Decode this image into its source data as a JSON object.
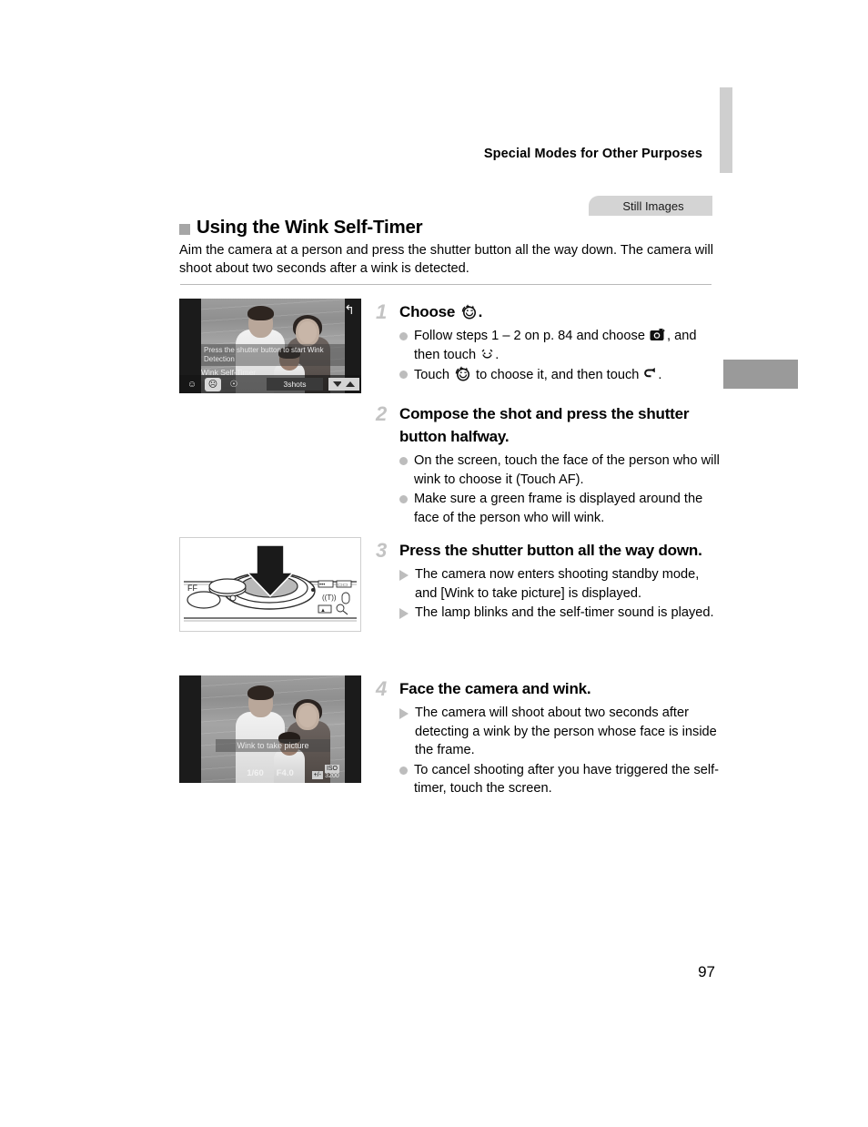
{
  "header": {
    "running_head": "Special Modes for Other Purposes"
  },
  "badge": {
    "label": "Still Images"
  },
  "section": {
    "title": "Using the Wink Self-Timer",
    "intro": "Aim the camera at a person and press the shutter button all the way down. The camera will shoot about two seconds after a wink is detected."
  },
  "figures": {
    "lcd1": {
      "message": "Press the shutter button to start Wink Detection",
      "mode_label": "Wink Self-Timer",
      "shots_value": "3shots",
      "back_icon": "back-arrow-icon",
      "timer_icons": [
        "face-self-timer-icon",
        "wink-self-timer-icon",
        "custom-self-timer-icon"
      ],
      "selected_timer_index": 1,
      "down_arrow": "chevron-down-icon",
      "up_arrow": "chevron-up-icon"
    },
    "camera": {
      "name": "camera-top-shutter-button-diagram",
      "arrow": "press-down-arrow-icon",
      "labels": [
        "FF"
      ]
    },
    "lcd2": {
      "hint": "Wink to take picture",
      "shutter_speed": "1/60",
      "aperture": "F4.0",
      "iso_label": "ISO",
      "iso_value": "3200",
      "exposure_chip": "+/-"
    }
  },
  "steps": [
    {
      "num": "1",
      "title_before": "Choose",
      "title_icon": "wink-self-timer-icon",
      "title_after": ".",
      "items": [
        {
          "marker": "dot",
          "segments": [
            {
              "text": "Follow steps 1 – 2 on p. 84 and choose "
            },
            {
              "icon": "face-self-timer-menu-icon"
            },
            {
              "text": ", and then touch "
            },
            {
              "icon": "smile-face-icon"
            },
            {
              "text": "."
            }
          ]
        },
        {
          "marker": "dot",
          "segments": [
            {
              "text": "Touch "
            },
            {
              "icon": "wink-self-timer-icon"
            },
            {
              "text": " to choose it, and then touch "
            },
            {
              "icon": "back-arrow-icon"
            },
            {
              "text": "."
            }
          ]
        }
      ]
    },
    {
      "num": "2",
      "title_before": "Compose the shot and press the shutter button halfway.",
      "items": [
        {
          "marker": "dot",
          "segments": [
            {
              "text": "On the screen, touch the face of the person who will wink to choose it (Touch AF)."
            }
          ]
        },
        {
          "marker": "dot",
          "segments": [
            {
              "text": "Make sure a green frame is displayed around the face of the person who will wink."
            }
          ]
        }
      ]
    },
    {
      "num": "3",
      "title_before": "Press the shutter button all the way down.",
      "items": [
        {
          "marker": "triangle",
          "segments": [
            {
              "text": "The camera now enters shooting standby mode, and [Wink to take picture] is displayed."
            }
          ]
        },
        {
          "marker": "triangle",
          "segments": [
            {
              "text": "The lamp blinks and the self-timer sound is played."
            }
          ]
        }
      ]
    },
    {
      "num": "4",
      "title_before": "Face the camera and wink.",
      "items": [
        {
          "marker": "triangle",
          "segments": [
            {
              "text": "The camera will shoot about two seconds after detecting a wink by the person whose face is inside the frame."
            }
          ]
        },
        {
          "marker": "dot",
          "segments": [
            {
              "text": "To cancel shooting after you have triggered the self-timer, touch the screen."
            }
          ]
        }
      ]
    }
  ],
  "footer": {
    "page_number": "97"
  },
  "colors": {
    "tab_light": "#cfcfcf",
    "tab_dark": "#9a9a9a",
    "badge_bg": "#d4d4d4",
    "marker_gray": "#bdbdbd",
    "step_num_gray": "#c3c3c3"
  }
}
